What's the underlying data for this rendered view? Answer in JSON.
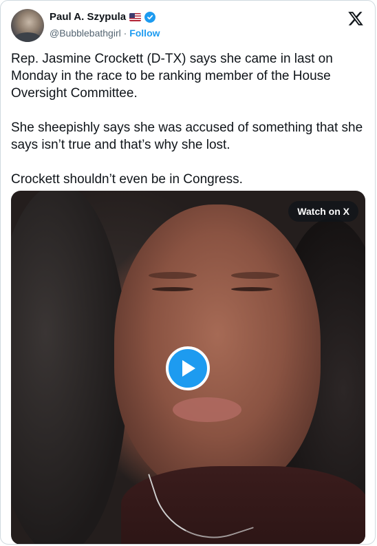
{
  "author": {
    "display_name": "Paul A. Szypula",
    "handle": "@Bubblebathgirl",
    "separator": "·",
    "follow_label": "Follow",
    "flag_icon": "us-flag-icon",
    "verified_icon": "verified-badge-icon",
    "verified_color": "#1d9bf0"
  },
  "header": {
    "logo_icon": "x-logo-icon"
  },
  "tweet": {
    "paragraphs": [
      "Rep. Jasmine Crockett (D-TX) says she came in last on Monday in the race to be ranking member of the House Oversight Committee.",
      "She sheepishly says she was accused of something that she says isn’t true and that’s why she lost.",
      "Crockett shouldn’t even be in Congress."
    ]
  },
  "media": {
    "type": "video",
    "watch_label": "Watch on X",
    "play_icon": "play-icon",
    "accent": "#1d9bf0"
  }
}
